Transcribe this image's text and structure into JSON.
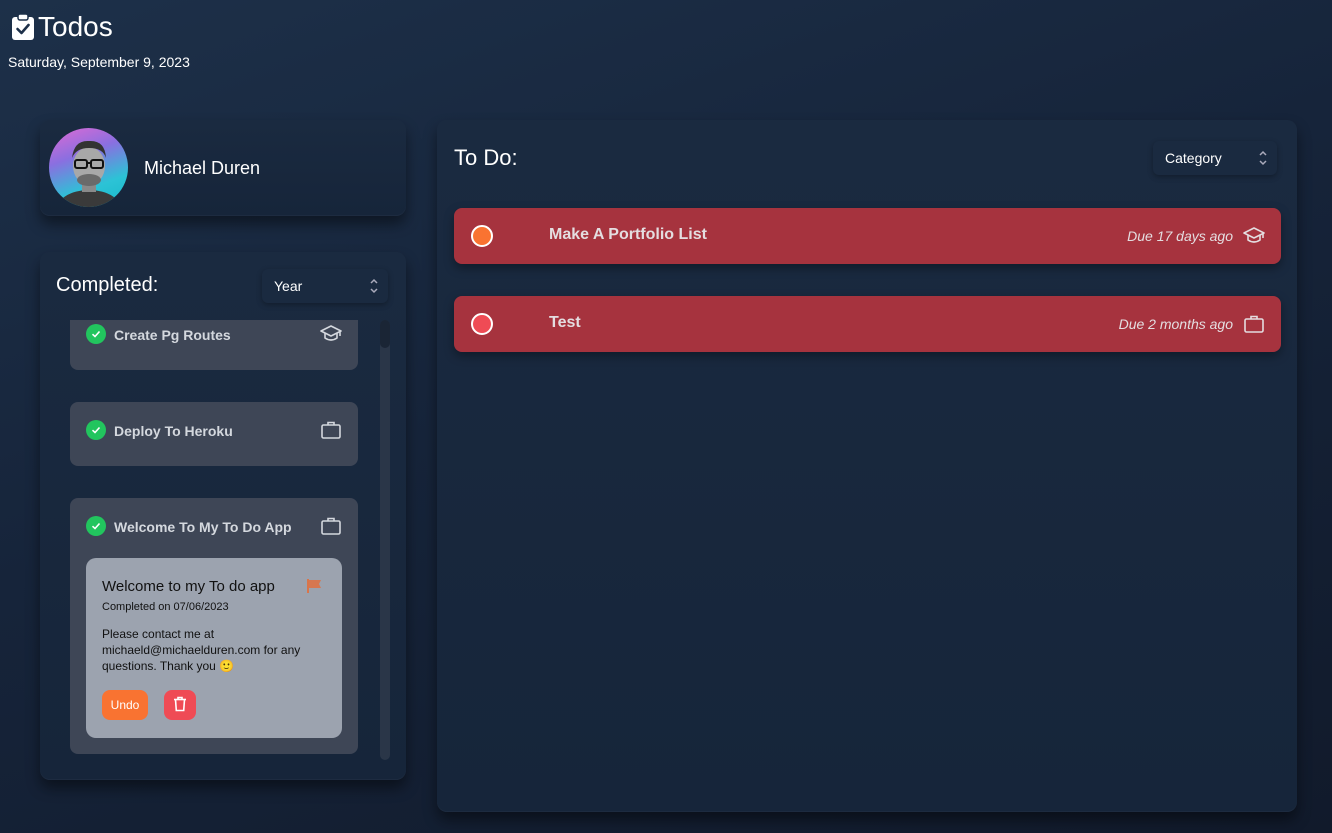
{
  "header": {
    "title": "Todos",
    "date": "Saturday, September 9, 2023"
  },
  "profile": {
    "name": "Michael Duren"
  },
  "completed": {
    "title": "Completed:",
    "filter": "Year",
    "items": [
      {
        "label": "Create Pg Routes",
        "category_icon": "graduation-cap-icon"
      },
      {
        "label": "Deploy To Heroku",
        "category_icon": "briefcase-icon"
      },
      {
        "label": "Welcome To My To Do App",
        "category_icon": "briefcase-icon"
      }
    ],
    "detail": {
      "title": "Welcome to my To do app",
      "completed_on": "Completed on 07/06/2023",
      "description": "Please contact me at michaeld@michaelduren.com for any questions. Thank you 🙂",
      "undo_label": "Undo"
    }
  },
  "todo": {
    "title": "To Do:",
    "filter": "Category",
    "items": [
      {
        "label": "Make A Portfolio List",
        "due": "Due 17 days ago",
        "circle_color": "#f97331",
        "category_icon": "graduation-cap-icon"
      },
      {
        "label": "Test",
        "due": "Due 2 months ago",
        "circle_color": "#ef4b55",
        "category_icon": "briefcase-icon"
      }
    ]
  },
  "colors": {
    "todo_background": "#a6333e",
    "completed_item_background": "#3e4656",
    "check_green": "#22c55e",
    "undo_orange": "#f97331",
    "delete_red": "#ef4b55",
    "flag_orange": "#e07040"
  }
}
